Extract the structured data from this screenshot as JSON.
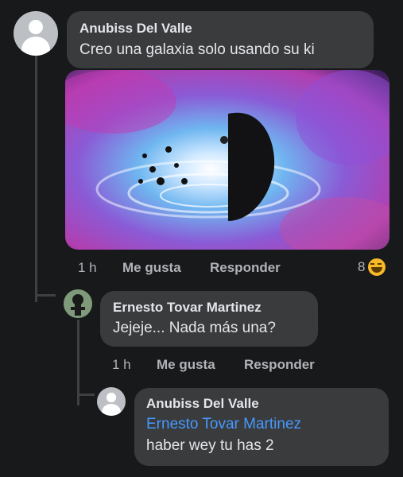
{
  "comments": [
    {
      "author": "Anubiss Del Valle",
      "text": "Creo una galaxia solo usando su ki",
      "time": "1 h",
      "like": "Me gusta",
      "reply": "Responder",
      "reaction_count": "8",
      "reaction_icon": "haha-emoji-icon"
    },
    {
      "author": "Ernesto Tovar Martinez",
      "text": "Jejeje... Nada más una?",
      "time": "1 h",
      "like": "Me gusta",
      "reply": "Responder"
    },
    {
      "author": "Anubiss Del Valle",
      "mention": "Ernesto Tovar Martinez",
      "text": "haber wey tu has 2"
    }
  ],
  "colors": {
    "background": "#18191a",
    "bubble": "#3a3b3c",
    "mention": "#4599ff",
    "reaction": "#f7b928"
  }
}
